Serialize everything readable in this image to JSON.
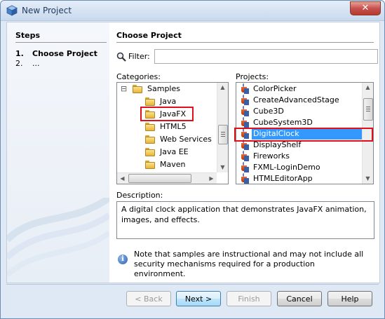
{
  "window": {
    "title": "New Project",
    "close_glyph": "✕"
  },
  "steps": {
    "title": "Steps",
    "items": [
      {
        "num": "1.",
        "label": "Choose Project"
      },
      {
        "num": "2.",
        "label": "..."
      }
    ]
  },
  "main": {
    "title": "Choose Project",
    "filter_label": "Filter:",
    "filter_value": "",
    "categories_label": "Categories:",
    "projects_label": "Projects:",
    "categories": [
      {
        "label": "Samples",
        "expander": "⊟"
      },
      {
        "label": "Java"
      },
      {
        "label": "JavaFX"
      },
      {
        "label": "HTML5"
      },
      {
        "label": "Web Services"
      },
      {
        "label": "Java EE"
      },
      {
        "label": "Maven"
      }
    ],
    "projects": [
      {
        "label": "ColorPicker"
      },
      {
        "label": "CreateAdvancedStage"
      },
      {
        "label": "Cube3D"
      },
      {
        "label": "CubeSystem3D"
      },
      {
        "label": "DigitalClock"
      },
      {
        "label": "DisplayShelf"
      },
      {
        "label": "Fireworks"
      },
      {
        "label": "FXML-LoginDemo"
      },
      {
        "label": "HTMLEditorApp"
      }
    ],
    "description_label": "Description:",
    "description": "A digital clock application that demonstrates JavaFX animation, images, and effects.",
    "note": "Note that samples are instructional and may not include all security mechanisms required for a production environment.",
    "info_glyph": "i"
  },
  "scroll": {
    "up": "▲",
    "down": "▼",
    "left": "◀",
    "right": "▶"
  },
  "buttons": {
    "back": "< Back",
    "next": "Next >",
    "finish": "Finish",
    "cancel": "Cancel",
    "help": "Help"
  },
  "colors": {
    "selection": "#3399ff",
    "highlight_box": "#e0101a"
  }
}
